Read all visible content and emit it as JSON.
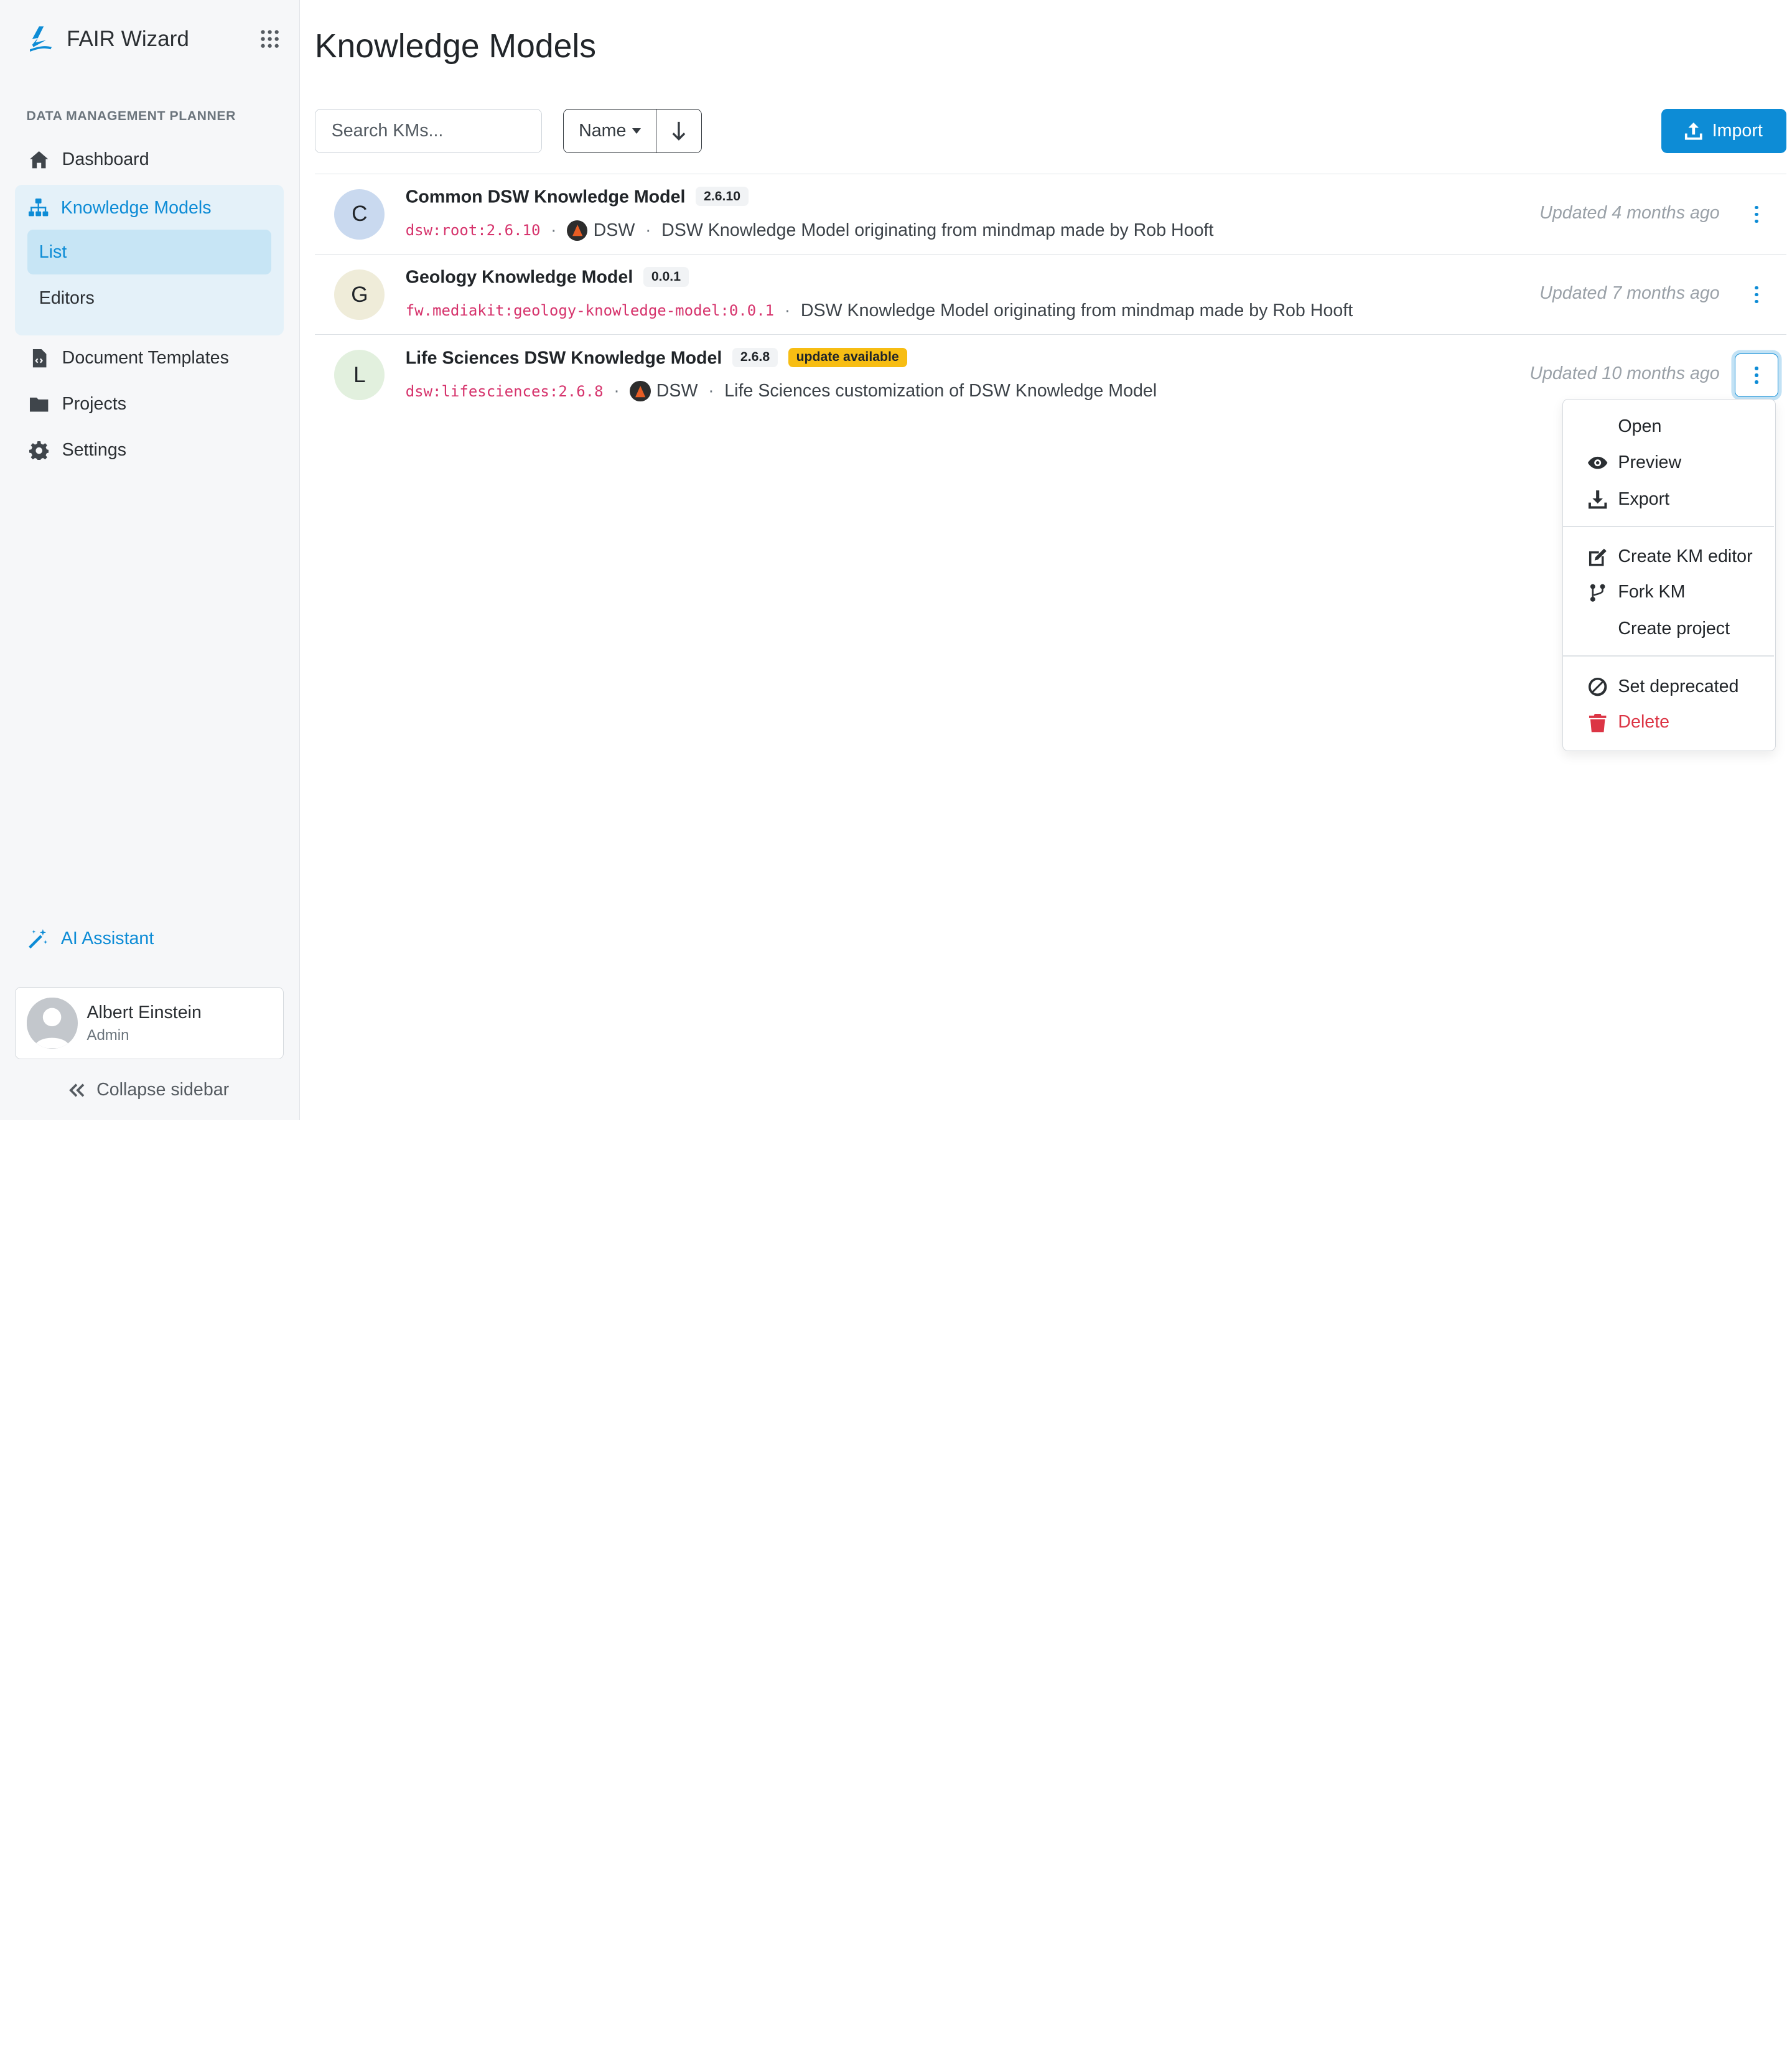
{
  "brand": {
    "name": "FAIR Wizard",
    "accent": "#0d8cd6"
  },
  "sidebar": {
    "section_title": "DATA MANAGEMENT PLANNER",
    "items": [
      {
        "label": "Dashboard",
        "icon": "home-icon"
      },
      {
        "label": "Knowledge Models",
        "icon": "sitemap-icon",
        "active": true
      },
      {
        "label": "Document Templates",
        "icon": "file-code-icon"
      },
      {
        "label": "Projects",
        "icon": "folder-icon"
      },
      {
        "label": "Settings",
        "icon": "gear-icon"
      }
    ],
    "km_subitems": [
      {
        "label": "List",
        "active": true
      },
      {
        "label": "Editors"
      }
    ],
    "ai_assistant": "AI Assistant",
    "profile": {
      "name": "Albert Einstein",
      "role": "Admin"
    },
    "collapse_label": "Collapse sidebar"
  },
  "main": {
    "title": "Knowledge Models",
    "search_placeholder": "Search KMs...",
    "sort_label": "Name",
    "sort_direction": "descending",
    "import_label": "Import",
    "items": [
      {
        "initial": "C",
        "avatar_color": "#c9d9ef",
        "name": "Common DSW Knowledge Model",
        "version": "2.6.10",
        "id": "dsw:root:2.6.10",
        "org": "DSW",
        "description": "DSW Knowledge Model originating from mindmap made by Rob Hooft",
        "updated": "Updated 4 months ago"
      },
      {
        "initial": "G",
        "avatar_color": "#efecd9",
        "name": "Geology Knowledge Model",
        "version": "0.0.1",
        "id": "fw.mediakit:geology-knowledge-model:0.0.1",
        "description": "DSW Knowledge Model originating from mindmap made by Rob Hooft",
        "updated": "Updated 7 months ago"
      },
      {
        "initial": "L",
        "avatar_color": "#e2f0de",
        "name": "Life Sciences DSW Knowledge Model",
        "version": "2.6.8",
        "badge": "update available",
        "id": "dsw:lifesciences:2.6.8",
        "org": "DSW",
        "description": "Life Sciences customization of DSW Knowledge Model",
        "updated": "Updated 10 months ago"
      }
    ]
  },
  "dropdown": {
    "items": [
      {
        "label": "Open",
        "icon": ""
      },
      {
        "label": "Preview",
        "icon": "eye-icon"
      },
      {
        "label": "Export",
        "icon": "download-icon"
      },
      {
        "label": "Create KM editor",
        "icon": "edit-icon"
      },
      {
        "label": "Fork KM",
        "icon": "code-fork-icon"
      },
      {
        "label": "Create project",
        "icon": ""
      },
      {
        "label": "Set deprecated",
        "icon": "ban-icon"
      },
      {
        "label": "Delete",
        "icon": "trash-icon",
        "danger": true
      }
    ]
  }
}
